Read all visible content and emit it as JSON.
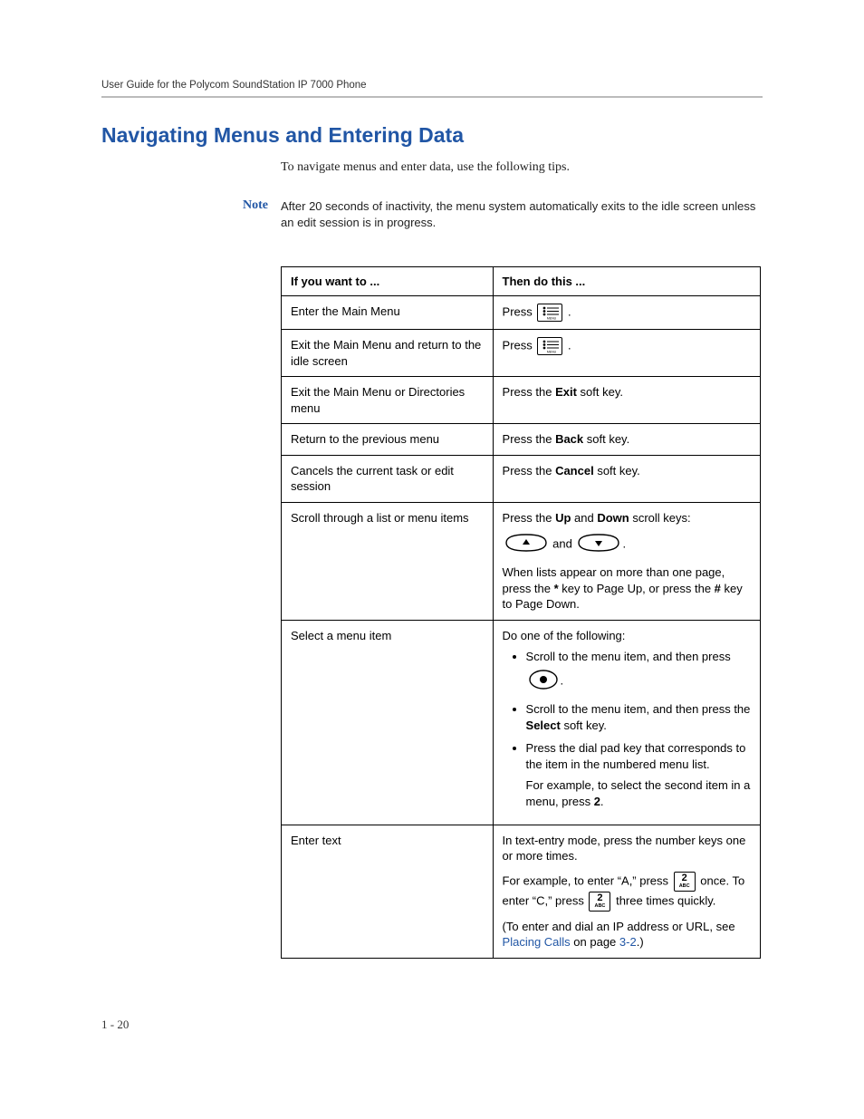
{
  "header": {
    "running": "User Guide for the Polycom SoundStation IP 7000 Phone"
  },
  "section": {
    "title": "Navigating Menus and Entering Data",
    "intro": "To navigate menus and enter data, use the following tips."
  },
  "note": {
    "label": "Note",
    "text": "After 20 seconds of inactivity, the menu system automatically exits to the idle screen unless an edit session is in progress."
  },
  "table": {
    "head_left": "If you want to ...",
    "head_right": "Then do this ...",
    "rows": {
      "r1": {
        "left": "Enter the Main Menu",
        "press": "Press"
      },
      "r2": {
        "left": "Exit the Main Menu and return to the idle screen",
        "press": "Press"
      },
      "r3": {
        "left": "Exit the Main Menu or Directories menu",
        "right_pre": "Press the ",
        "right_bold": "Exit",
        "right_post": " soft key."
      },
      "r4": {
        "left": "Return to the previous menu",
        "right_pre": "Press the ",
        "right_bold": "Back",
        "right_post": " soft key."
      },
      "r5": {
        "left": "Cancels the current task or edit session",
        "right_pre": "Press the ",
        "right_bold": "Cancel",
        "right_post": " soft key."
      },
      "r6": {
        "left": "Scroll through a list or menu items",
        "p1_pre": "Press the ",
        "p1_b1": "Up",
        "p1_mid": " and ",
        "p1_b2": "Down",
        "p1_post": " scroll keys:",
        "and": " and ",
        "p3_a": "When lists appear on more than one page, press the ",
        "p3_b1": "*",
        "p3_b": " key to Page Up, or press the ",
        "p3_b2": "#",
        "p3_c": " key to Page Down."
      },
      "r7": {
        "left": "Select a menu item",
        "lead": "Do one of the following:",
        "b1": "Scroll to the menu item, and then press",
        "b2_pre": "Scroll to the menu item, and then press the ",
        "b2_bold": "Select",
        "b2_post": " soft key.",
        "b3a": "Press the dial pad key that corresponds to the item in the numbered menu list.",
        "b3b_pre": "For example, to select the second item in a menu, press ",
        "b3b_bold": "2",
        "b3b_post": "."
      },
      "r8": {
        "left": "Enter text",
        "p1": "In text-entry mode, press the number keys one or more times.",
        "p2a": "For example, to enter “A,” press ",
        "p2b": " once. To enter “C,” press ",
        "p2c": " three times quickly.",
        "p3a": "(To enter and dial an IP address or URL, see ",
        "p3link": "Placing Calls",
        "p3b": " on page ",
        "p3page": "3-2",
        "p3c": ".)"
      }
    }
  },
  "footer": {
    "page": "1 - 20"
  },
  "icons": {
    "menu_label": "MENU",
    "key2_big": "2",
    "key2_small": "ABC"
  }
}
